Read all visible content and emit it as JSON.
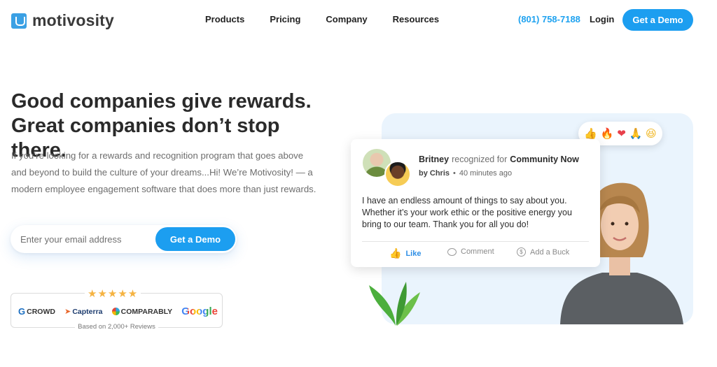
{
  "header": {
    "brand": "motivosity",
    "nav": [
      "Products",
      "Pricing",
      "Company",
      "Resources"
    ],
    "phone": "(801) 758-7188",
    "login": "Login",
    "cta": "Get a Demo"
  },
  "hero": {
    "headline_line1": "Good companies give rewards.",
    "headline_line2": "Great companies don’t stop there.",
    "subtext": "If you’re looking for a rewards and recognition program that goes above and beyond to build the culture of your dreams...Hi! We’re Motivosity! — a modern employee engagement software that does more than just rewards.",
    "email_placeholder": "Enter your email address",
    "cta": "Get a Demo"
  },
  "reviews": {
    "stars": "★★★★★",
    "rating_count": 5,
    "logos": [
      "CROWD",
      "Capterra",
      "COMPARABLY",
      "Google"
    ],
    "caption": "Based on 2,000+ Reviews"
  },
  "reactions": [
    "thumbs-up",
    "fire",
    "heart",
    "pray",
    "laugh"
  ],
  "card": {
    "recipient": "Britney",
    "recognized_for": "recognized for",
    "value": "Community Now",
    "by": "by Chris",
    "time": "40 minutes ago",
    "message": "I have an endless amount of things to say about you. Whether it’s your work ethic or the positive energy you bring to our team. Thank you for all you do!",
    "actions": {
      "like": "Like",
      "comment": "Comment",
      "buck": "Add a Buck"
    }
  },
  "colors": {
    "accent": "#1c9ef0",
    "panel": "#eaf4fd",
    "stars": "#f5b342"
  }
}
